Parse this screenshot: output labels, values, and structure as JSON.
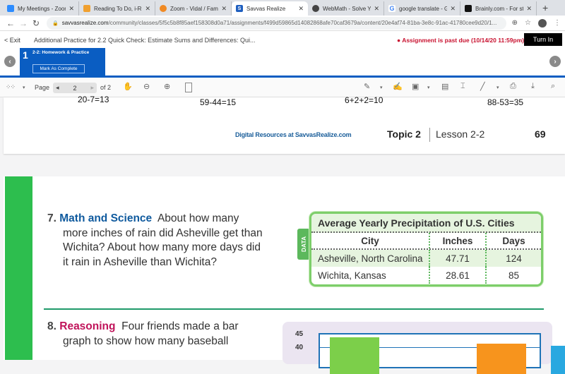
{
  "browser": {
    "tabs": [
      {
        "label": "My Meetings - Zoom",
        "icon": "zoom-icon",
        "color": "#2d8cff",
        "active": false
      },
      {
        "label": "Reading To Do, i-Ready",
        "icon": "iready-icon",
        "color": "#f0a030",
        "active": false
      },
      {
        "label": "Zoom - Vidal / Fampr",
        "icon": "zoom-orange-icon",
        "color": "#f08a24",
        "active": false
      },
      {
        "label": "Savvas Realize",
        "icon": "savvas-icon",
        "color": "#1f5fbf",
        "active": true
      },
      {
        "label": "WebMath - Solve Your",
        "icon": "globe-icon",
        "color": "#444444",
        "active": false
      },
      {
        "label": "google translate - Go",
        "icon": "google-icon",
        "color": "#4285f4",
        "active": false
      },
      {
        "label": "Brainly.com - For stud",
        "icon": "brainly-icon",
        "color": "#111111",
        "active": false
      }
    ],
    "new_tab": "+",
    "url_host": "savvasrealize.com",
    "url_path": "/community/classes/5f5c5b8f85aef158308d0a71/assignments/f499d59865d14082868afe70caf3679a/content/20e4af74-81ba-3e8c-91ac-41780cee9d20/1..."
  },
  "header": {
    "exit_label": "< Exit",
    "title": "Additional Practice for 2.2 Quick Check: Estimate Sums and Differences: Qui...",
    "past_due": "Assignment is past due (10/14/20 11:59pm)",
    "turn_in": "Turn In",
    "item_number": "1",
    "item_label": "2-2: Homework & Practice",
    "mark_complete": "Mark As Complete",
    "accent": "#0a5dc2"
  },
  "pdf_toolbar": {
    "page_label": "Page",
    "page_current": "2",
    "page_total": "of 2"
  },
  "page_top": {
    "equations": [
      "20-7=13",
      "59-44=15",
      "6+2+2=10",
      "88-53=35"
    ],
    "digital_resources": "Digital Resources at SavvasRealize.com",
    "topic": "Topic 2",
    "lesson": "Lesson 2-2",
    "page_number": "69"
  },
  "question7": {
    "number": "7.",
    "title": "Math and Science",
    "line1": "About how many",
    "line2": "more inches of rain did Asheville get than",
    "line3": "Wichita? About how many more days did",
    "line4": "it rain in Asheville than Wichita?"
  },
  "data_table": {
    "tag": "DATA",
    "title": "Average Yearly Precipitation of U.S. Cities",
    "headers": [
      "City",
      "Inches",
      "Days"
    ],
    "rows": [
      [
        "Asheville, North Carolina",
        "47.71",
        "124"
      ],
      [
        "Wichita, Kansas",
        "28.61",
        "85"
      ]
    ]
  },
  "question8": {
    "number": "8.",
    "title": "Reasoning",
    "line1": "Four friends made a bar",
    "line2": "graph to show how many baseball"
  },
  "bar_chart_preview": {
    "y_ticks": [
      "45",
      "40"
    ],
    "ylim_visible": [
      40,
      45
    ],
    "bars": [
      {
        "color": "#7ccf4a",
        "value": 44
      },
      {
        "color": "#f7941d",
        "value": 41.5
      },
      {
        "color": "#29a8e0",
        "value": 40.5
      }
    ]
  }
}
